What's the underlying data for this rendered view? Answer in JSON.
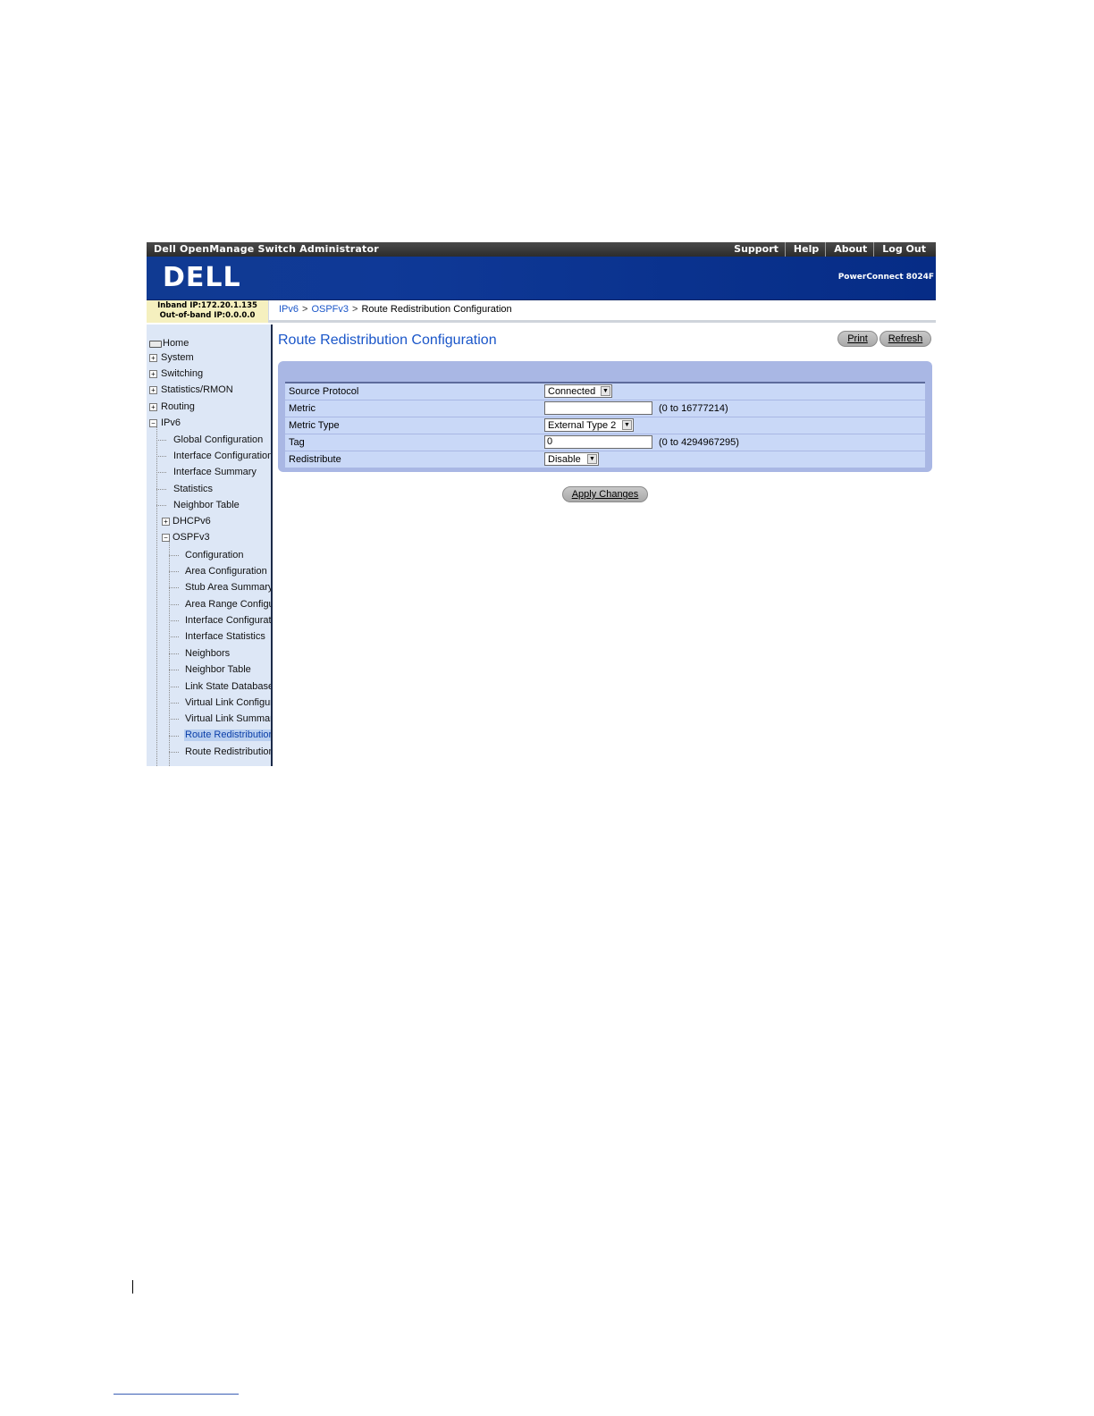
{
  "window": {
    "app_title": "Dell OpenManage Switch Administrator",
    "top_links": [
      "Support",
      "Help",
      "About",
      "Log Out"
    ]
  },
  "banner": {
    "logo_text": "DELL",
    "product_name": "PowerConnect 8024F"
  },
  "device_info": {
    "inband": "Inband IP:172.20.1.135",
    "outofband": "Out-of-band IP:0.0.0.0"
  },
  "breadcrumb": {
    "items": [
      "IPv6",
      "OSPFv3",
      "Route Redistribution Configuration"
    ],
    "separator": ">"
  },
  "sidebar": {
    "home": "Home",
    "level1": [
      "System",
      "Switching",
      "Statistics/RMON",
      "Routing",
      "IPv6"
    ],
    "ipv6_children": [
      "Global Configuration",
      "Interface Configuration",
      "Interface Summary",
      "Statistics",
      "Neighbor Table",
      "DHCPv6",
      "OSPFv3"
    ],
    "ospfv3_children": [
      "Configuration",
      "Area Configuration",
      "Stub Area Summary",
      "Area Range Configuration",
      "Interface Configuration",
      "Interface Statistics",
      "Neighbors",
      "Neighbor Table",
      "Link State Database",
      "Virtual Link Configuration",
      "Virtual Link Summary",
      "Route Redistribution Configuration",
      "Route Redistribution Summary"
    ]
  },
  "page": {
    "title": "Route Redistribution Configuration",
    "print_label": "Print",
    "refresh_label": "Refresh",
    "apply_label": "Apply Changes"
  },
  "form": {
    "source_protocol": {
      "label": "Source Protocol",
      "value": "Connected"
    },
    "metric": {
      "label": "Metric",
      "value": "",
      "range": "(0 to 16777214)"
    },
    "metric_type": {
      "label": "Metric Type",
      "value": "External Type 2"
    },
    "tag": {
      "label": "Tag",
      "value": "0",
      "range": "(0 to 4294967295)"
    },
    "redistribute": {
      "label": "Redistribute",
      "value": "Disable"
    }
  },
  "colors": {
    "banner": "#0f3997",
    "accent_text": "#1a56c9",
    "panel": "#a9b7e4",
    "row": "#c9d8f7",
    "sidebar": "#dde7f6"
  }
}
